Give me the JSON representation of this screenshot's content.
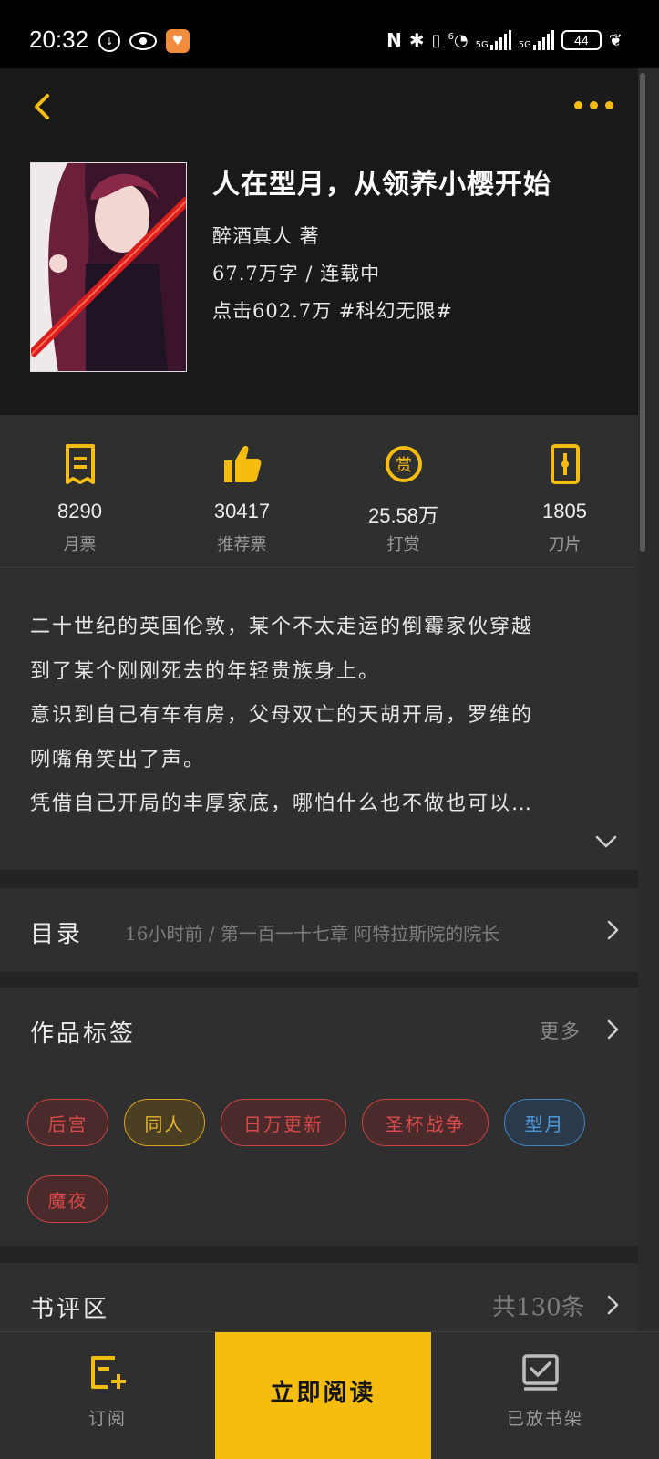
{
  "status_bar": {
    "time": "20:32",
    "network_label": "5G",
    "network_label_2": "5G",
    "wifi_label": "6",
    "battery": "44",
    "nfc_label": "N"
  },
  "header": {
    "back_icon": "chevron-left-icon",
    "more_icon": "more-dots-icon",
    "accent_color": "#f5bd10"
  },
  "book": {
    "title": "人在型月，从领养小樱开始",
    "author_line": "醉酒真人  著",
    "words_status": "67.7万字 / 连载中",
    "clicks_genre": "点击602.7万  #科幻无限#"
  },
  "stats": [
    {
      "icon": "ticket-icon",
      "value": "8290",
      "label": "月票"
    },
    {
      "icon": "thumbs-up-icon",
      "value": "30417",
      "label": "推荐票"
    },
    {
      "icon": "reward-icon",
      "value": "25.58万",
      "label": "打赏"
    },
    {
      "icon": "blade-icon",
      "value": "1805",
      "label": "刀片"
    }
  ],
  "description": {
    "lines": [
      "二十世纪的英国伦敦，某个不太走运的倒霉家伙穿越",
      "到了某个刚刚死去的年轻贵族身上。",
      "意识到自己有车有房，父母双亡的天胡开局，罗维的",
      "咧嘴角笑出了声。",
      "凭借自己开局的丰厚家底，哪怕什么也不做也可以…"
    ],
    "expand_icon": "chevron-down-icon"
  },
  "toc": {
    "title": "目录",
    "latest": "16小时前 / 第一百一十七章 阿特拉斯院的院长"
  },
  "tags": {
    "title": "作品标签",
    "more": "更多",
    "items": [
      {
        "label": "后宫",
        "color": "red"
      },
      {
        "label": "同人",
        "color": "yellow"
      },
      {
        "label": "日万更新",
        "color": "red"
      },
      {
        "label": "圣杯战争",
        "color": "red"
      },
      {
        "label": "型月",
        "color": "blue"
      },
      {
        "label": "魔夜",
        "color": "red"
      }
    ]
  },
  "reviews": {
    "title": "书评区",
    "count": "共130条"
  },
  "bottom_bar": {
    "subscribe": "订阅",
    "read_now": "立即阅读",
    "on_shelf": "已放书架"
  }
}
